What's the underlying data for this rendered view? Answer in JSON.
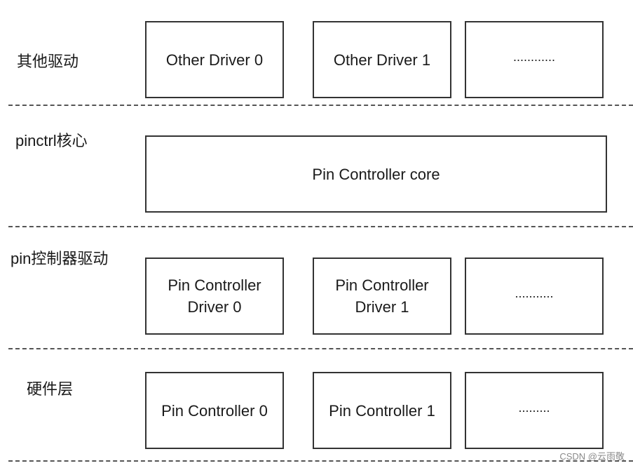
{
  "layers": [
    {
      "label": "其他驱动",
      "boxes": [
        "Other Driver 0",
        "Other Driver 1",
        "............"
      ]
    },
    {
      "label": "pinctrl核心",
      "boxes": [
        "Pin Controller core"
      ]
    },
    {
      "label": "pin控制器驱动",
      "boxes": [
        {
          "line1": "Pin Controller",
          "line2": "Driver 0"
        },
        {
          "line1": "Pin Controller",
          "line2": "Driver 1"
        },
        "..........."
      ]
    },
    {
      "label": "硬件层",
      "boxes": [
        "Pin Controller 0",
        "Pin Controller 1",
        "........."
      ]
    }
  ],
  "watermark": "CSDN @云雨敬",
  "colors": {
    "border": "#333333",
    "divider": "#555555",
    "text": "#1a1a1a"
  }
}
